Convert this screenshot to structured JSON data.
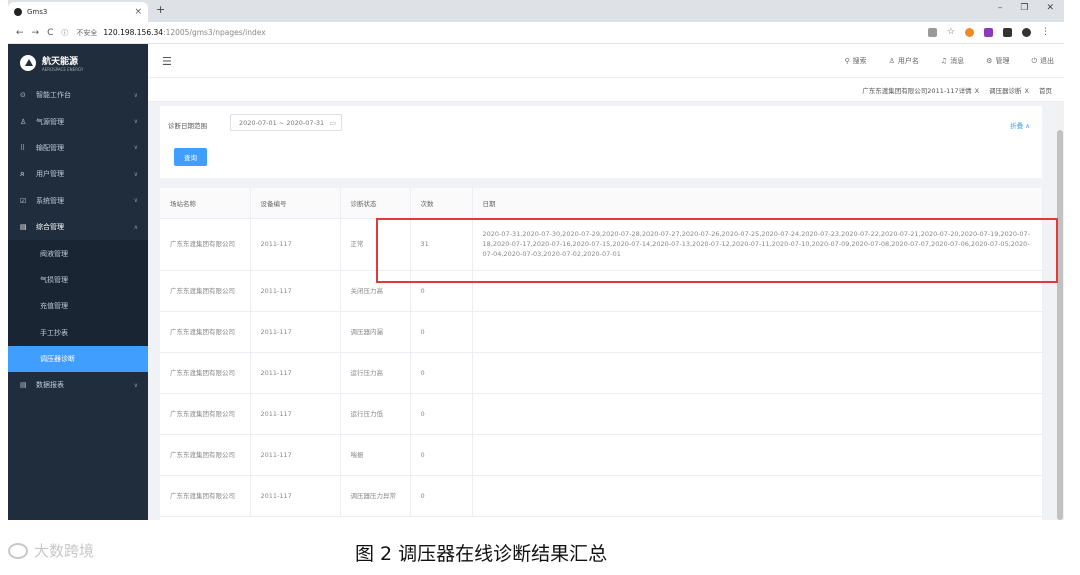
{
  "browser": {
    "tab_title": "Gms3",
    "tab_close": "×",
    "new_tab": "+",
    "security_label": "不安全",
    "url_host": "120.198.156.34",
    "url_path": ":12005/gms3/npages/index"
  },
  "sidebar": {
    "logo_text": "航天能源",
    "logo_sub": "AEROSPACE ENERGY",
    "items": [
      {
        "icon": "⊙",
        "label": "智能工作台"
      },
      {
        "icon": "♙",
        "label": "气源管理"
      },
      {
        "icon": "⠿",
        "label": "输配管理"
      },
      {
        "icon": "ᴙ",
        "label": "用户管理"
      },
      {
        "icon": "☑",
        "label": "系统管理"
      },
      {
        "icon": "▤",
        "label": "综合管理"
      }
    ],
    "sub_items": [
      "阀液管理",
      "气损管理",
      "充值管理",
      "手工抄表",
      "调压器诊断"
    ],
    "last_item": {
      "icon": "▤",
      "label": "数据报表"
    }
  },
  "header": {
    "search": "搜索",
    "username": "用户名",
    "messages": "消息",
    "manage": "管理",
    "logout": "退出"
  },
  "tags": [
    "广东东渡集团有限公司2011-117详情",
    "调压器诊断",
    "首页"
  ],
  "filter": {
    "label": "诊断日期范围",
    "date_range": "2020-07-01 ~ 2020-07-31",
    "query_button": "查询",
    "collapse": "折叠 ∧"
  },
  "table": {
    "headers": [
      "场站名称",
      "设备编号",
      "诊断状态",
      "次数",
      "日期"
    ],
    "rows": [
      {
        "station": "广东东渡集团有限公司",
        "device": "2011-117",
        "status": "正常",
        "count": "31",
        "dates": "2020-07-31,2020-07-30,2020-07-29,2020-07-28,2020-07-27,2020-07-26,2020-07-25,2020-07-24,2020-07-23,2020-07-22,2020-07-21,2020-07-20,2020-07-19,2020-07-18,2020-07-17,2020-07-16,2020-07-15,2020-07-14,2020-07-13,2020-07-12,2020-07-11,2020-07-10,2020-07-09,2020-07-08,2020-07-07,2020-07-06,2020-07-05,2020-07-04,2020-07-03,2020-07-02,2020-07-01"
      },
      {
        "station": "广东东渡集团有限公司",
        "device": "2011-117",
        "status": "关闭压力高",
        "count": "0",
        "dates": ""
      },
      {
        "station": "广东东渡集团有限公司",
        "device": "2011-117",
        "status": "调压器内漏",
        "count": "0",
        "dates": ""
      },
      {
        "station": "广东东渡集团有限公司",
        "device": "2011-117",
        "status": "运行压力高",
        "count": "0",
        "dates": ""
      },
      {
        "station": "广东东渡集团有限公司",
        "device": "2011-117",
        "status": "运行压力低",
        "count": "0",
        "dates": ""
      },
      {
        "station": "广东东渡集团有限公司",
        "device": "2011-117",
        "status": "喘振",
        "count": "0",
        "dates": ""
      },
      {
        "station": "广东东渡集团有限公司",
        "device": "2011-117",
        "status": "调压器压力异常",
        "count": "0",
        "dates": ""
      }
    ]
  },
  "caption": "图 2  调压器在线诊断结果汇总",
  "watermark": "大数跨境",
  "colors": {
    "sidebar_bg": "#1f2d3d",
    "accent": "#409eff",
    "highlight": "#e03a3a"
  }
}
